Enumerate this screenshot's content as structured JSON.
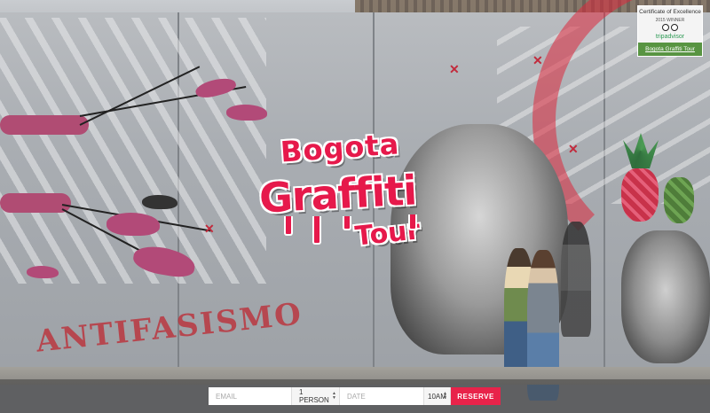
{
  "badge": {
    "title": "Certificate of Excellence",
    "year_line": "2015 WINNER",
    "brand": "tripadvisor",
    "link": "Bogota Graffiti Tour",
    "icon": "tripadvisor-owl-icon"
  },
  "logo": {
    "line1": "Bogota",
    "line2": "Graffiti",
    "line3": "Tour"
  },
  "wall_text": {
    "graffiti": "ANTIFASISMO"
  },
  "booking": {
    "email_placeholder": "EMAIL",
    "persons_value": "1 PERSON",
    "date_placeholder": "DATE",
    "time_value": "10AM",
    "reserve_label": "RESERVE"
  },
  "colors": {
    "accent": "#e8234a",
    "badge_green": "#589442"
  }
}
